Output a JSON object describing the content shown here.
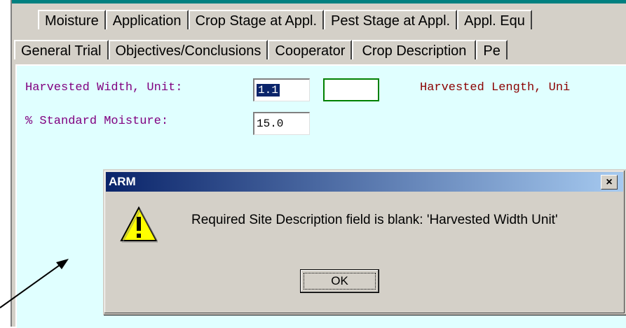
{
  "tabs_back": [
    "Moisture",
    "Application",
    "Crop Stage at Appl.",
    "Pest Stage at Appl.",
    "Appl. Equ"
  ],
  "tabs_front": [
    "General Trial",
    "Objectives/Conclusions",
    "Cooperator",
    "Crop Description",
    "Pe"
  ],
  "active_tab": "Crop Description",
  "form": {
    "harvested_width_label": "Harvested Width, Unit:",
    "harvested_width_value": "1.1",
    "harvested_length_label": "Harvested Length, Uni",
    "standard_moisture_label": "% Standard Moisture:",
    "standard_moisture_value": "15.0"
  },
  "dialog": {
    "title": "ARM",
    "close_label": "×",
    "message": "Required Site Description field is blank: 'Harvested Width Unit'",
    "ok_label": "OK"
  },
  "colors": {
    "panel_bg": "#e0ffff",
    "purple_label": "#800080",
    "red_label": "#8b0000",
    "titlebar_start": "#0a246a",
    "titlebar_end": "#a6caf0"
  },
  "icons": {
    "dialog_icon": "warning-icon",
    "annotation": "arrow"
  }
}
